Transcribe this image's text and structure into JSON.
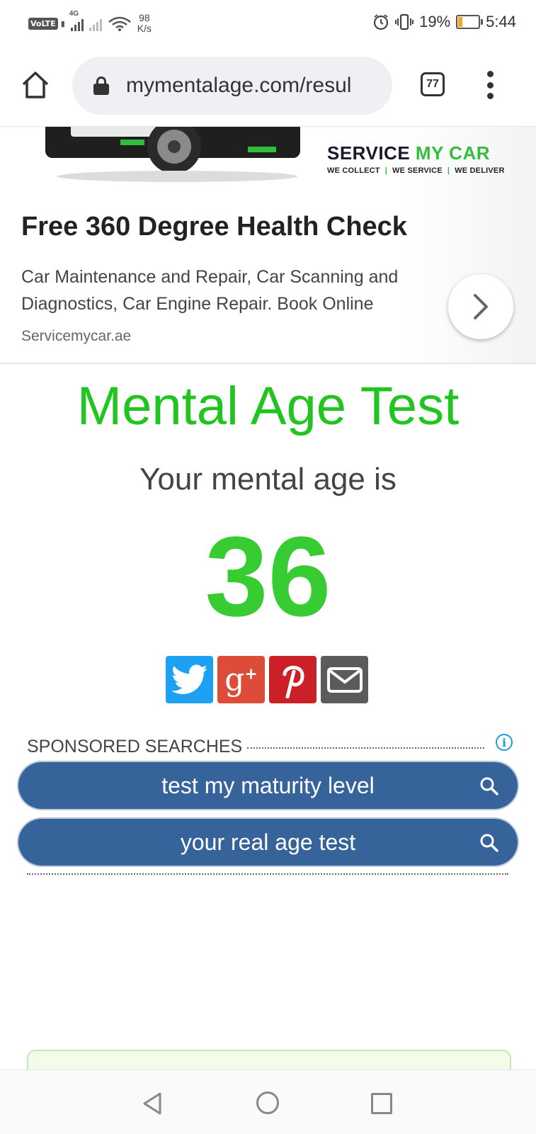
{
  "status_bar": {
    "volte": "VoLTE",
    "network": "4G",
    "net_speed_value": "98",
    "net_speed_unit": "K/s",
    "battery_percent": "19%",
    "battery_level": 0.19,
    "time": "5:44",
    "icons": [
      "signal-icon",
      "wifi-icon",
      "alarm-icon",
      "vibrate-icon",
      "battery-icon"
    ]
  },
  "browser": {
    "url": "mymentalage.com/resul",
    "tab_count": "77",
    "icons": [
      "home-icon",
      "lock-icon",
      "tabs-icon",
      "more-vert-icon"
    ]
  },
  "ad": {
    "brand_prefix": "SERVICE ",
    "brand_highlight": "MY C",
    "brand_accent": "A",
    "brand_suffix": "R",
    "tagline": [
      "WE COLLECT",
      "WE SERVICE",
      "WE DELIVER"
    ],
    "title": "Free 360 Degree Health Check",
    "description": "Car Maintenance and Repair, Car Scanning and Diagnostics, Car Engine Repair. Book Online",
    "display_url": "Servicemycar.ae",
    "brand_color": "#2fbf3a"
  },
  "main": {
    "title": "Mental Age Test",
    "subtitle": "Your mental age is",
    "age_value": "36",
    "accent_color": "#22c41f"
  },
  "share": [
    {
      "name": "twitter",
      "color": "#1da1f2"
    },
    {
      "name": "google-plus",
      "label": "g",
      "sup": "+",
      "color": "#dd4b39"
    },
    {
      "name": "pinterest",
      "color": "#cb2027"
    },
    {
      "name": "email",
      "color": "#5b5b5b"
    }
  ],
  "sponsored": {
    "heading": "SPONSORED SEARCHES",
    "items": [
      {
        "label": "test my maturity level"
      },
      {
        "label": "your real age test"
      }
    ],
    "pill_color": "#36649a"
  },
  "navbar": {
    "icons": [
      "back-icon",
      "home-circle-icon",
      "recents-icon"
    ]
  }
}
